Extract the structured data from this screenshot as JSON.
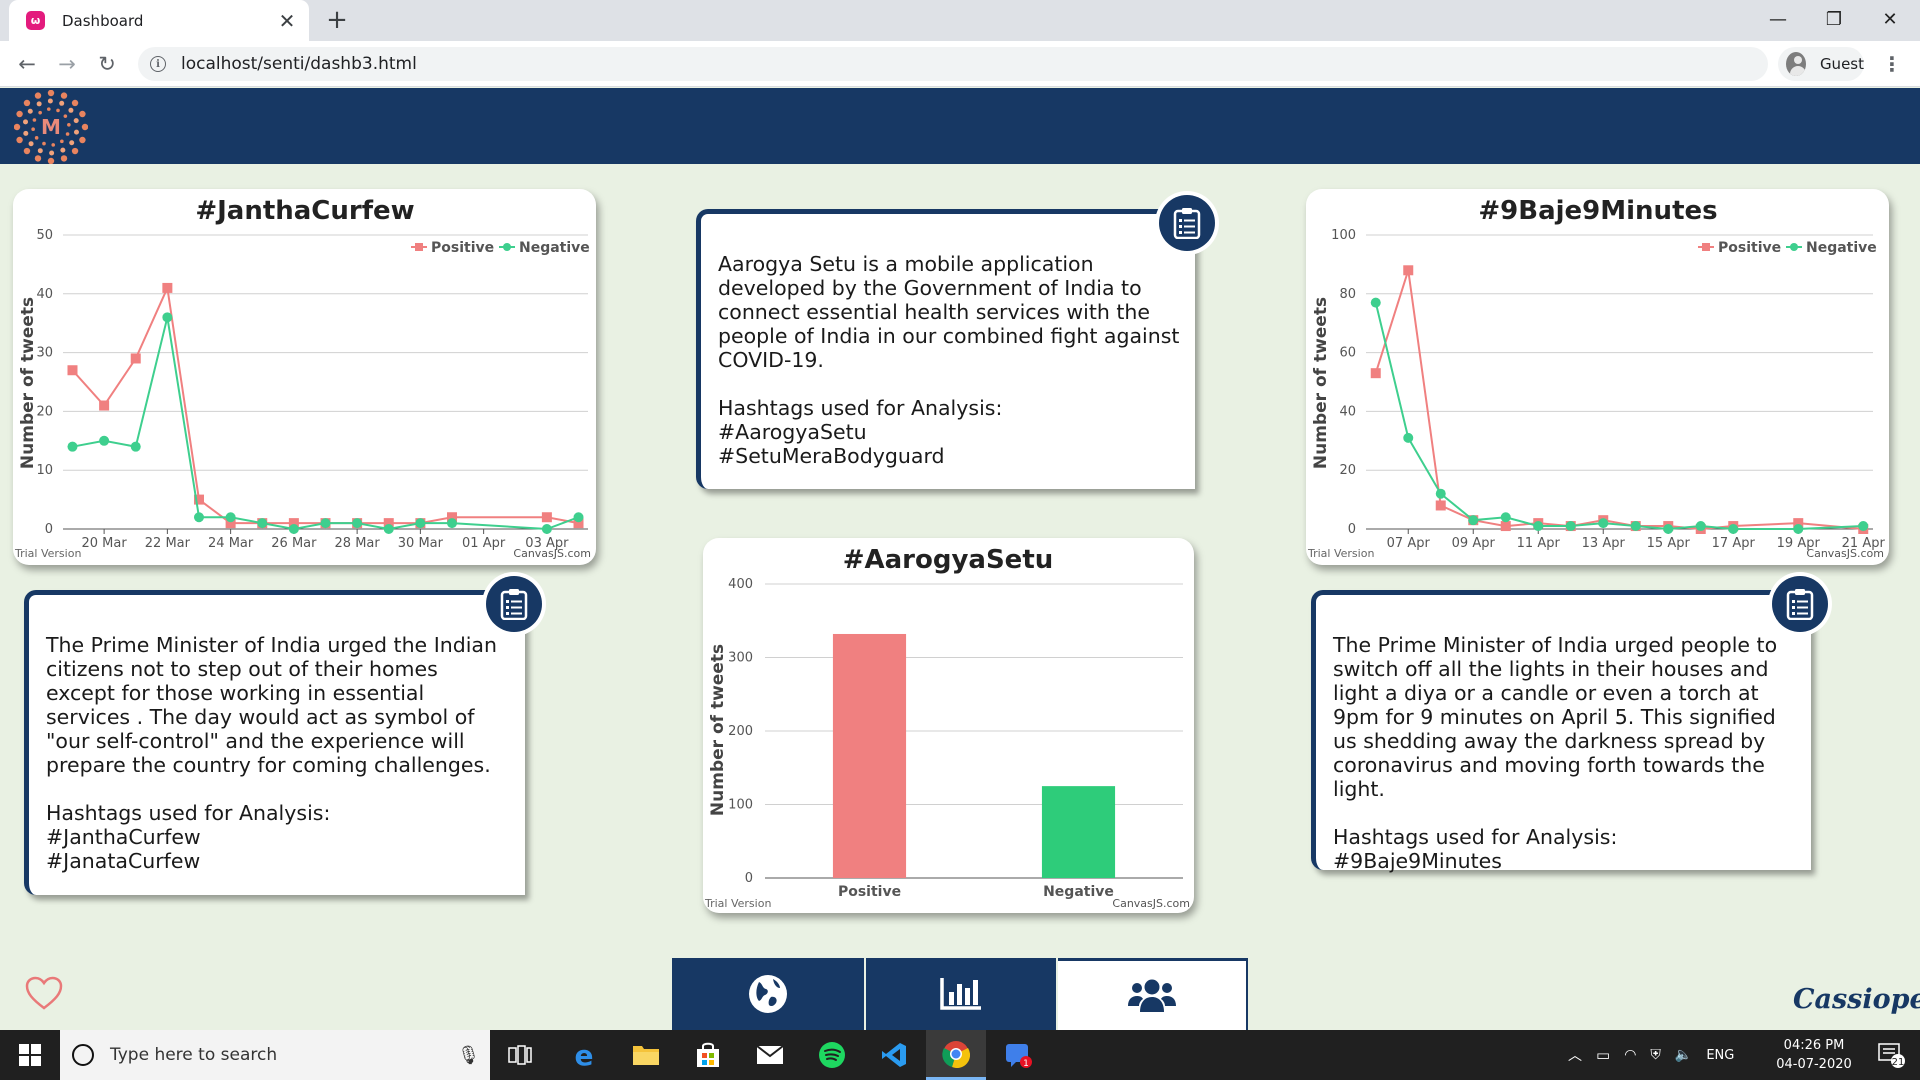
{
  "browser": {
    "tab_title": "Dashboard",
    "tab_close": "✕",
    "new_tab": "+",
    "url": "localhost/senti/dashb3.html",
    "profile_label": "Guest",
    "window_controls": {
      "minimize": "—",
      "maximize": "❐",
      "close": "✕"
    }
  },
  "charts": {
    "janthacurfew": {
      "title": "#JanthaCurfew",
      "ylabel": "Number of tweets",
      "trial": "Trial Version",
      "credit": "CanvasJS.com",
      "legend": [
        "Positive",
        "Negative"
      ]
    },
    "baje9": {
      "title": "#9Baje9Minutes",
      "ylabel": "Number of tweets",
      "trial": "Trial Version",
      "credit": "CanvasJS.com",
      "legend": [
        "Positive",
        "Negative"
      ]
    },
    "aarogya": {
      "title": "#AarogyaSetu",
      "ylabel": "Number of tweets",
      "trial": "Trial Version",
      "credit": "CanvasJS.com"
    }
  },
  "chart_data": [
    {
      "type": "line",
      "title": "#JanthaCurfew",
      "ylabel": "Number of tweets",
      "ylim": [
        0,
        50
      ],
      "yticks": [
        0,
        10,
        20,
        30,
        40,
        50
      ],
      "xticks": [
        "20 Mar",
        "22 Mar",
        "24 Mar",
        "26 Mar",
        "28 Mar",
        "30 Mar",
        "01 Apr",
        "03 Apr"
      ],
      "x": [
        "19 Mar",
        "20 Mar",
        "21 Mar",
        "22 Mar",
        "23 Mar",
        "24 Mar",
        "25 Mar",
        "26 Mar",
        "27 Mar",
        "28 Mar",
        "29 Mar",
        "30 Mar",
        "31 Mar",
        "03 Apr",
        "04 Apr"
      ],
      "series": [
        {
          "name": "Positive",
          "color": "#f08080",
          "marker": "square",
          "values": [
            27,
            21,
            29,
            41,
            5,
            1,
            1,
            1,
            1,
            1,
            1,
            1,
            2,
            2,
            1
          ]
        },
        {
          "name": "Negative",
          "color": "#3ecf8e",
          "marker": "circle",
          "values": [
            14,
            15,
            14,
            36,
            2,
            2,
            1,
            0,
            1,
            1,
            0,
            1,
            1,
            0,
            2
          ]
        }
      ],
      "legend": "top-right",
      "grid": true
    },
    {
      "type": "line",
      "title": "#9Baje9Minutes",
      "ylabel": "Number of tweets",
      "ylim": [
        0,
        100
      ],
      "yticks": [
        0,
        20,
        40,
        60,
        80,
        100
      ],
      "xticks": [
        "07 Apr",
        "09 Apr",
        "11 Apr",
        "13 Apr",
        "15 Apr",
        "17 Apr",
        "19 Apr",
        "21 Apr"
      ],
      "x": [
        "06 Apr",
        "07 Apr",
        "08 Apr",
        "09 Apr",
        "10 Apr",
        "11 Apr",
        "12 Apr",
        "13 Apr",
        "14 Apr",
        "15 Apr",
        "16 Apr",
        "17 Apr",
        "19 Apr",
        "21 Apr"
      ],
      "series": [
        {
          "name": "Positive",
          "color": "#f08080",
          "marker": "square",
          "values": [
            53,
            88,
            8,
            3,
            1,
            2,
            1,
            3,
            1,
            1,
            0,
            1,
            2,
            0
          ]
        },
        {
          "name": "Negative",
          "color": "#3ecf8e",
          "marker": "circle",
          "values": [
            77,
            31,
            12,
            3,
            4,
            1,
            1,
            2,
            1,
            0,
            1,
            0,
            0,
            1
          ]
        }
      ],
      "legend": "top-right",
      "grid": true
    },
    {
      "type": "bar",
      "title": "#AarogyaSetu",
      "ylabel": "Number of tweets",
      "ylim": [
        0,
        400
      ],
      "yticks": [
        0,
        100,
        200,
        300,
        400
      ],
      "categories": [
        "Positive",
        "Negative"
      ],
      "values": [
        332,
        125
      ],
      "colors": [
        "#f08080",
        "#2ecc7a"
      ],
      "grid": true
    }
  ],
  "descriptions": {
    "aarogya": {
      "text": "Aarogya Setu is a mobile application developed by the Government of India to connect essential health services with the people of India in our combined fight against COVID-19.",
      "hashtags_label": "Hashtags used for Analysis:",
      "hashtags": [
        "#AarogyaSetu",
        "#SetuMeraBodyguard"
      ]
    },
    "jantha": {
      "text": "The Prime Minister of India urged the Indian citizens not to step out of their homes except for those working in essential services . The day would act as symbol of \"our self-control\" and the experience will prepare the country for coming challenges.",
      "hashtags_label": "Hashtags used for Analysis:",
      "hashtags": [
        "#JanthaCurfew",
        "#JanataCurfew"
      ]
    },
    "baje9": {
      "text": "The Prime Minister of India urged people to switch off all the lights in their houses and light a diya or a candle or even a torch at 9pm for 9 minutes on April 5. This signified us shedding away the darkness spread by coronavirus and moving forth towards the light.",
      "hashtags_label": "Hashtags used for Analysis:",
      "hashtags": [
        "#9Baje9Minutes"
      ]
    }
  },
  "brand": {
    "logo_letter": "M",
    "signature": "Cassiopeia"
  },
  "bottom_nav": {
    "active_index": 2,
    "items": [
      "globe-icon",
      "bar-chart-icon",
      "users-icon"
    ]
  },
  "taskbar": {
    "search_placeholder": "Type here to search",
    "language": "ENG",
    "time": "04:26 PM",
    "date": "04-07-2020",
    "notification_count": "21",
    "mail_badge": "1"
  }
}
